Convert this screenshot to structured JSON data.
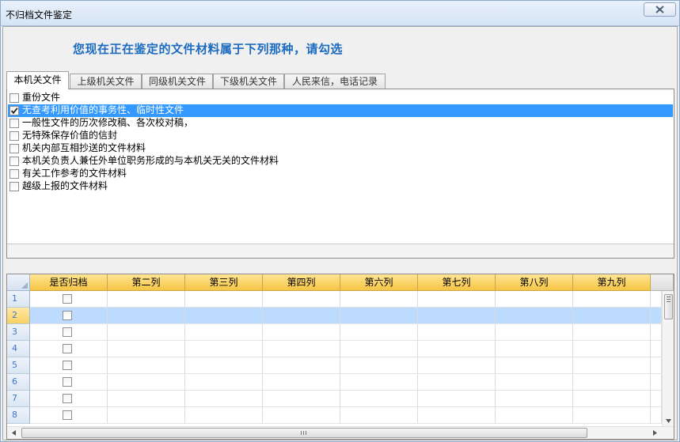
{
  "window": {
    "title": "不归档文件鉴定"
  },
  "heading": "您现在正在鉴定的文件材料属于下列那种，请勾选",
  "tabs": [
    {
      "label": "本机关文件",
      "active": true
    },
    {
      "label": "上级机关文件",
      "active": false
    },
    {
      "label": "同级机关文件",
      "active": false
    },
    {
      "label": "下级机关文件",
      "active": false
    },
    {
      "label": "人民来信，电话记录",
      "active": false
    }
  ],
  "checklist": [
    {
      "label": "重份文件",
      "checked": false,
      "selected": false
    },
    {
      "label": "无查考利用价值的事务性、临时性文件",
      "checked": true,
      "selected": true
    },
    {
      "label": "一般性文件的历次修改稿、各次校对稿，",
      "checked": false,
      "selected": false
    },
    {
      "label": "无特殊保存价值的信封",
      "checked": false,
      "selected": false
    },
    {
      "label": "机关内部互相抄送的文件材料",
      "checked": false,
      "selected": false
    },
    {
      "label": "本机关负责人兼任外单位职务形成的与本机关无关的文件材料",
      "checked": false,
      "selected": false
    },
    {
      "label": "有关工作参考的文件材料",
      "checked": false,
      "selected": false
    },
    {
      "label": "越级上报的文件材料",
      "checked": false,
      "selected": false
    }
  ],
  "grid": {
    "columns": [
      "是否归档",
      "第二列",
      "第三列",
      "第四列",
      "第六列",
      "第七列",
      "第八列",
      "第九列",
      ""
    ],
    "rows": [
      {
        "num": "1",
        "archived": false,
        "selected": false
      },
      {
        "num": "2",
        "archived": false,
        "selected": true
      },
      {
        "num": "3",
        "archived": false,
        "selected": false
      },
      {
        "num": "4",
        "archived": false,
        "selected": false
      },
      {
        "num": "5",
        "archived": false,
        "selected": false
      },
      {
        "num": "6",
        "archived": false,
        "selected": false
      },
      {
        "num": "7",
        "archived": false,
        "selected": false
      },
      {
        "num": "8",
        "archived": false,
        "selected": false
      }
    ]
  },
  "colors": {
    "heading": "#1c6bc0",
    "selection": "#3399ff",
    "grid_header": "#f6c544",
    "grid_selection": "#bcdbff"
  },
  "icons": {
    "close": "close-icon",
    "checkmark": "checkmark-icon",
    "scroll_down": "arrow-down-icon",
    "scroll_left": "arrow-left-icon",
    "scroll_right": "arrow-right-icon"
  }
}
